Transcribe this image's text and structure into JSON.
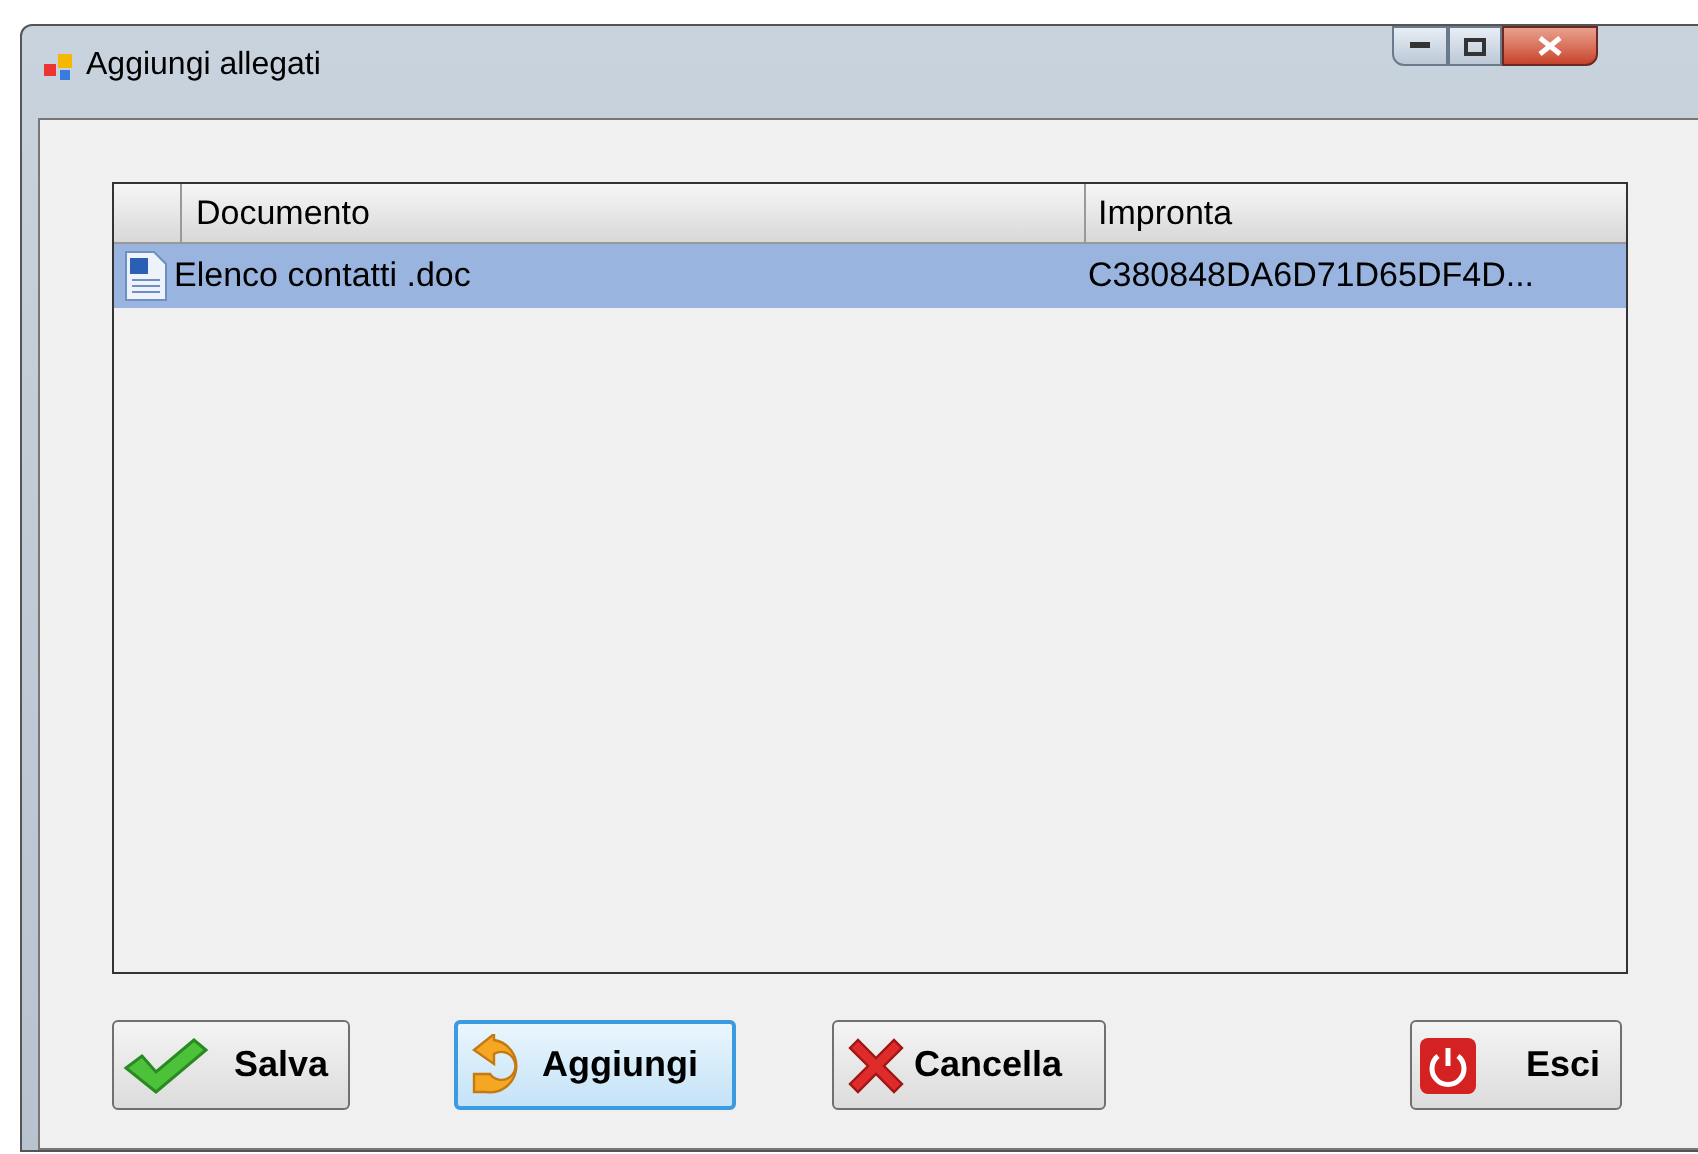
{
  "window": {
    "title": "Aggiungi allegati"
  },
  "table": {
    "columns": [
      "Documento",
      "Impronta"
    ],
    "rows": [
      {
        "cells": [
          "Elenco contatti .doc",
          "C380848DA6D71D65DF4D..."
        ],
        "selected": true
      }
    ]
  },
  "buttons": [
    {
      "label": "Salva",
      "kind": "save",
      "focused": false
    },
    {
      "label": "Aggiungi",
      "kind": "add",
      "focused": true
    },
    {
      "label": "Cancella",
      "kind": "delete",
      "focused": false
    },
    {
      "label": "Esci",
      "kind": "exit",
      "focused": false
    }
  ]
}
